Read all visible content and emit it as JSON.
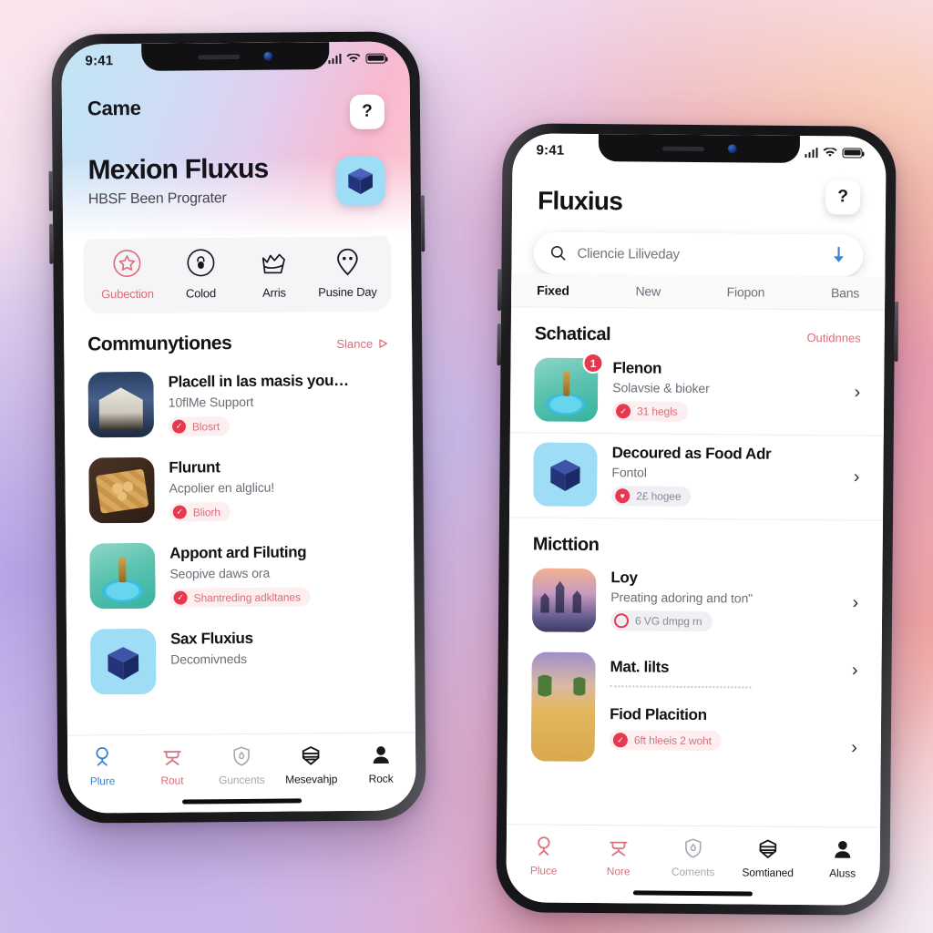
{
  "meta": {
    "accent_pink": "#e2697a",
    "accent_red": "#e8384f",
    "accent_blue": "#3b82d6"
  },
  "phone_left": {
    "status": {
      "time": "9:41",
      "signal_icon": "cellular-bars-icon",
      "wifi_icon": "wifi-icon",
      "battery_icon": "battery-icon"
    },
    "header": {
      "kicker": "Came",
      "title": "Mexion Fluxus",
      "subtitle": "HBSF Been Prograter",
      "help_button": "?",
      "badge_icon": "cube-logo-icon"
    },
    "categories": [
      {
        "label": "Gubection",
        "icon": "star-circle-icon",
        "accent": true
      },
      {
        "label": "Colod",
        "icon": "lock-circle-icon",
        "accent": false
      },
      {
        "label": "Arris",
        "icon": "crown-basket-icon",
        "accent": false
      },
      {
        "label": "Pusine Day",
        "icon": "pin-dots-icon",
        "accent": false
      }
    ],
    "section": {
      "title": "Communytiones",
      "link": "Slance",
      "link_icon": "play-triangle-icon"
    },
    "items": [
      {
        "title": "Placell in las masis you…",
        "subtitle": "10flMe Support",
        "pill": "Blosrt",
        "art": "art-house"
      },
      {
        "title": "Flurunt",
        "subtitle": "Acpolier en alglicu!",
        "pill": "Bliorh",
        "art": "art-food"
      },
      {
        "title": "Appont ard Filuting",
        "subtitle": "Seopive daws ora",
        "pill": "Shantreding adkltanes",
        "art": "art-teal"
      },
      {
        "title": "Sax Fluxius",
        "subtitle": "Decomivneds",
        "pill": "",
        "art": "art-cube"
      }
    ],
    "tabs": [
      {
        "label": "Plure",
        "icon": "person-head-icon",
        "color": "#3b82d6"
      },
      {
        "label": "Rout",
        "icon": "table-stand-icon",
        "color": "#d9707e"
      },
      {
        "label": "Guncents",
        "icon": "shield-drop-icon",
        "color": "#a9a9b4"
      },
      {
        "label": "Mesevahjp",
        "icon": "hexagon-card-icon",
        "color": "#17171b"
      },
      {
        "label": "Rock",
        "icon": "user-solid-icon",
        "color": "#17171b"
      }
    ]
  },
  "phone_right": {
    "status": {
      "time": "9:41",
      "signal_icon": "cellular-bars-icon",
      "wifi_icon": "wifi-icon",
      "battery_icon": "battery-icon"
    },
    "header": {
      "title": "Fluxius",
      "help_button": "?"
    },
    "search": {
      "placeholder": "Cliencie Liliveday",
      "search_icon": "search-icon",
      "trailing_icon": "download-arrow-icon"
    },
    "tabs": [
      {
        "label": "Fixed",
        "active": true
      },
      {
        "label": "New",
        "active": false
      },
      {
        "label": "Fiopon",
        "active": false
      },
      {
        "label": "Bans",
        "active": false
      }
    ],
    "sections": [
      {
        "title": "Schatical",
        "link": "Outidnnes",
        "items": [
          {
            "title": "Flenon",
            "subtitle": "Solavsie & bioker",
            "pill": "31 hegls",
            "badge": "1",
            "art": "art-teal",
            "pill_warm": true
          },
          {
            "title": "Decoured as Food Adr",
            "subtitle": "Fontol",
            "pill": "2£ hogee",
            "badge": "",
            "art": "art-cube",
            "pill_warm": false
          }
        ]
      },
      {
        "title": "Micttion",
        "link": "",
        "items": [
          {
            "title": "Loy",
            "subtitle": "Preating adoring and ton\"",
            "pill": "6 VG dmpg rn",
            "badge": "",
            "art": "art-city",
            "pill_warm": false
          },
          {
            "title": "Mat. lilts",
            "subtitle": "",
            "pill": "",
            "badge": "",
            "art": "art-field",
            "pill_warm": false
          },
          {
            "title": "Fiod Placition",
            "subtitle": "",
            "pill": "6ft hleeis 2 woht",
            "badge": "",
            "art": "art-green",
            "pill_warm": true
          }
        ]
      }
    ],
    "tabs_bottom": [
      {
        "label": "Pluce",
        "icon": "person-head-icon",
        "color": "#d9707e"
      },
      {
        "label": "Nore",
        "icon": "table-stand-icon",
        "color": "#d9707e"
      },
      {
        "label": "Coments",
        "icon": "shield-drop-icon",
        "color": "#a9a9b4"
      },
      {
        "label": "Somtianed",
        "icon": "hexagon-card-icon",
        "color": "#17171b"
      },
      {
        "label": "Aluss",
        "icon": "user-solid-icon",
        "color": "#17171b"
      }
    ]
  }
}
